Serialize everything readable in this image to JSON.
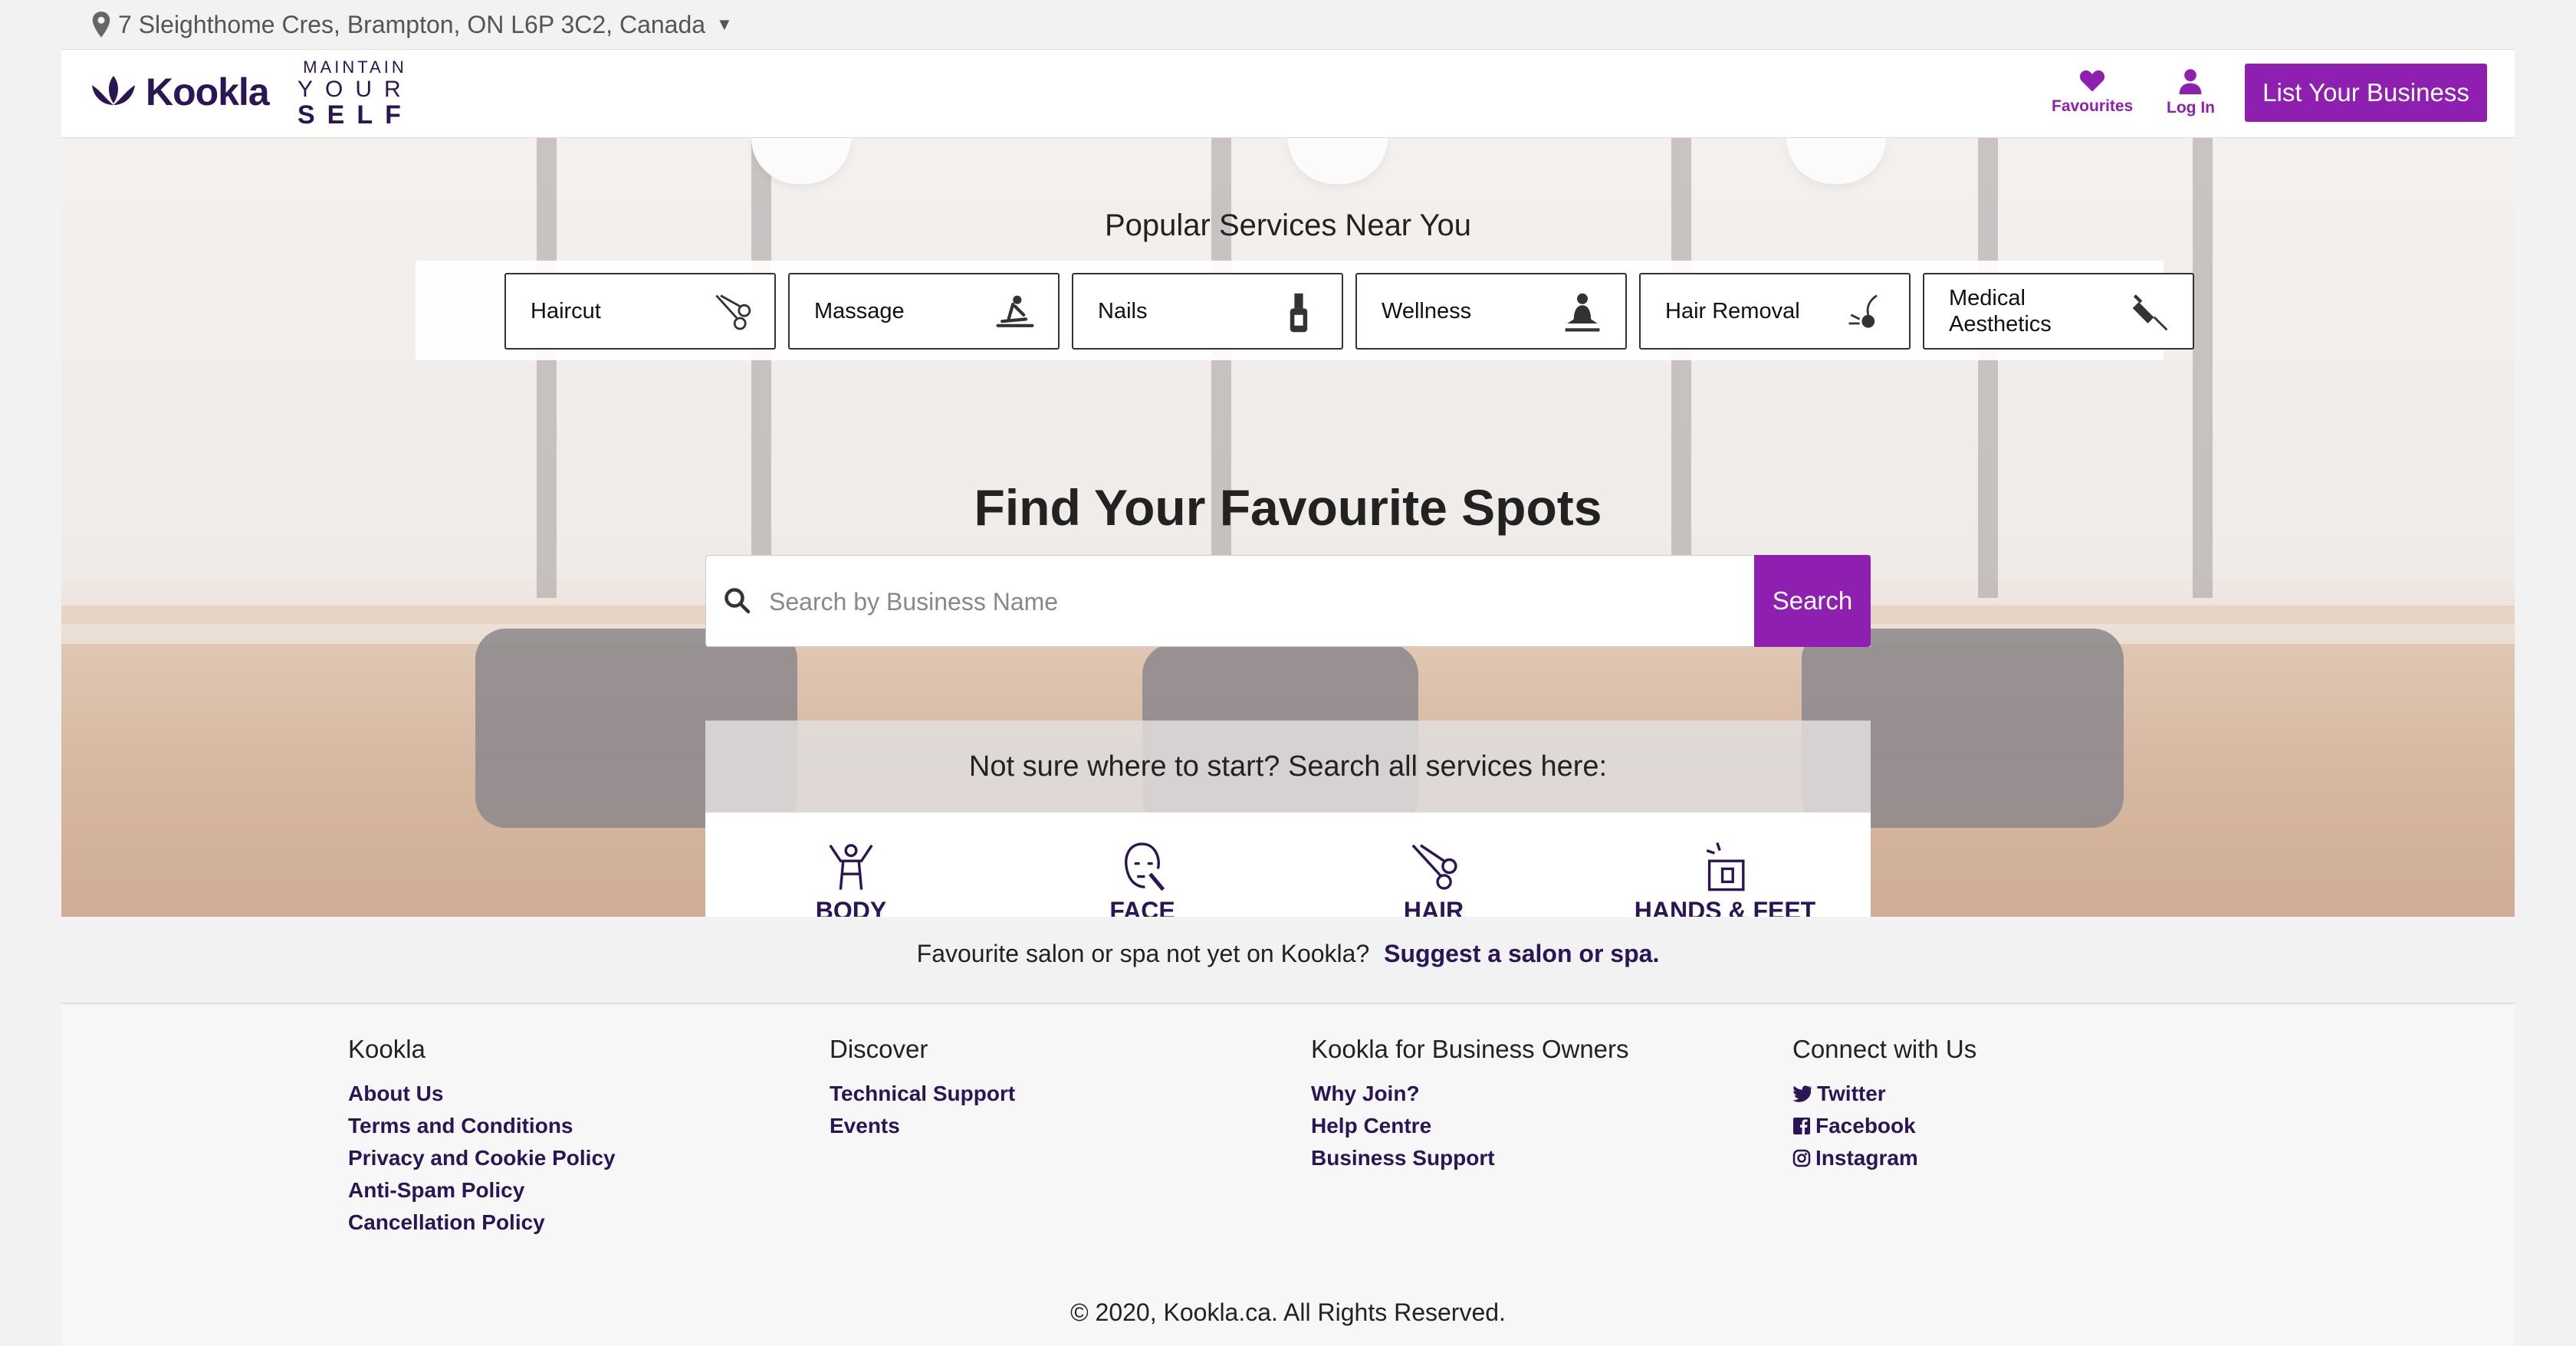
{
  "location": {
    "address": "7 Sleighthome Cres, Brampton, ON L6P 3C2, Canada"
  },
  "header": {
    "logo_text": "Kookla",
    "tagline": {
      "line1": "MAINTAIN",
      "line2": "YOUR",
      "line3": "SELF"
    },
    "favourites_label": "Favourites",
    "login_label": "Log In",
    "list_business_label": "List Your Business"
  },
  "hero": {
    "popular_title": "Popular Services Near You",
    "services": [
      {
        "label": "Haircut",
        "icon": "scissors-icon"
      },
      {
        "label": "Massage",
        "icon": "massage-icon"
      },
      {
        "label": "Nails",
        "icon": "nail-polish-icon"
      },
      {
        "label": "Wellness",
        "icon": "meditation-icon"
      },
      {
        "label": "Hair Removal",
        "icon": "hair-removal-icon"
      },
      {
        "label": "Medical Aesthetics",
        "icon": "syringe-icon"
      }
    ],
    "find_title": "Find Your Favourite Spots",
    "search_placeholder": "Search by Business Name",
    "search_button": "Search",
    "categories_title": "Not sure where to start? Search all services here:",
    "categories": [
      {
        "label": "BODY",
        "icon": "body-icon"
      },
      {
        "label": "FACE",
        "icon": "face-icon"
      },
      {
        "label": "HAIR",
        "icon": "hair-scissors-icon"
      },
      {
        "label": "HANDS & FEET",
        "icon": "hands-feet-icon"
      }
    ]
  },
  "suggest": {
    "text": "Favourite salon or spa not yet on Kookla?",
    "link": "Suggest a salon or spa."
  },
  "footer": {
    "columns": [
      {
        "title": "Kookla",
        "links": [
          "About Us",
          "Terms and Conditions",
          "Privacy and Cookie Policy",
          "Anti-Spam Policy",
          "Cancellation Policy"
        ]
      },
      {
        "title": "Discover",
        "links": [
          "Technical Support",
          "Events"
        ]
      },
      {
        "title": "Kookla for Business Owners",
        "links": [
          "Why Join?",
          "Help Centre",
          "Business Support"
        ]
      },
      {
        "title": "Connect with Us",
        "links": [
          "Twitter",
          "Facebook",
          "Instagram"
        ]
      }
    ],
    "copyright": "© 2020, Kookla.ca. All Rights Reserved."
  },
  "colors": {
    "brand_purple": "#8f1fb0",
    "brand_dark": "#2a1556"
  }
}
